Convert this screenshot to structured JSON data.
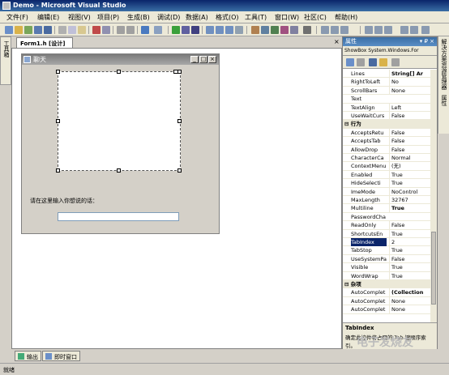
{
  "window": {
    "title": "Demo - Microsoft Visual Studio"
  },
  "menu": [
    "文件(F)",
    "编辑(E)",
    "视图(V)",
    "项目(P)",
    "生成(B)",
    "调试(D)",
    "数据(A)",
    "格式(O)",
    "工具(T)",
    "窗口(W)",
    "社区(C)",
    "帮助(H)"
  ],
  "left_toolbox_tab": "工具箱",
  "doc_tab": {
    "label": "Form1.h [设计]",
    "close": "×"
  },
  "form": {
    "title": "聊天",
    "prompt_label": "请在这里输入你想说的话："
  },
  "properties": {
    "title": "属性",
    "title_pin": "▾ ₽ ×",
    "object": "ShowBox System.Windows.For",
    "rows": [
      {
        "name": "Lines",
        "value": "String[] Ar",
        "bold": true
      },
      {
        "name": "RightToLeft",
        "value": "No"
      },
      {
        "name": "ScrollBars",
        "value": "None"
      },
      {
        "name": "Text",
        "value": ""
      },
      {
        "name": "TextAlign",
        "value": "Left"
      },
      {
        "name": "UseWaitCurs",
        "value": "False"
      },
      {
        "name": "⊟ 行为",
        "value": "",
        "cat": true
      },
      {
        "name": "AcceptsRetu",
        "value": "False"
      },
      {
        "name": "AcceptsTab",
        "value": "False"
      },
      {
        "name": "AllowDrop",
        "value": "False"
      },
      {
        "name": "CharacterCa",
        "value": "Normal"
      },
      {
        "name": "ContextMenu",
        "value": "(无)"
      },
      {
        "name": "Enabled",
        "value": "True"
      },
      {
        "name": "HideSelecti",
        "value": "True"
      },
      {
        "name": "ImeMode",
        "value": "NoControl"
      },
      {
        "name": "MaxLength",
        "value": "32767"
      },
      {
        "name": "Multiline",
        "value": "True",
        "bold": true
      },
      {
        "name": "PasswordCha",
        "value": ""
      },
      {
        "name": "ReadOnly",
        "value": "False"
      },
      {
        "name": "ShortcutsEn",
        "value": "True"
      },
      {
        "name": "TabIndex",
        "value": "2",
        "selected": true
      },
      {
        "name": "TabStop",
        "value": "True"
      },
      {
        "name": "UseSystemPa",
        "value": "False"
      },
      {
        "name": "Visible",
        "value": "True"
      },
      {
        "name": "WordWrap",
        "value": "True"
      },
      {
        "name": "⊟ 杂项",
        "value": "",
        "cat": true
      },
      {
        "name": "AutoComplet",
        "value": "(Collection",
        "bold": true
      },
      {
        "name": "AutoComplet",
        "value": "None"
      },
      {
        "name": "AutoComplet",
        "value": "None"
      }
    ],
    "desc_title": "TabIndex",
    "desc_text": "确定此控件将占用的 Tab 键顺序索引。"
  },
  "right_tabs": [
    "解决方案资源管理器",
    "属性"
  ],
  "bottom_tabs": [
    "输出",
    "即时窗口"
  ],
  "status": "就绪",
  "watermark": "电子发烧友"
}
